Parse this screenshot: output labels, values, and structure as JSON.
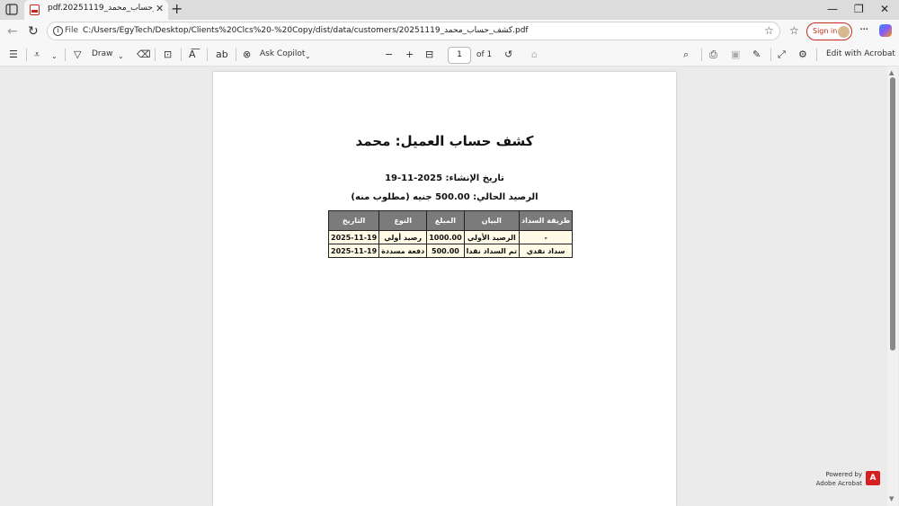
{
  "browser": {
    "tab_title": "pdf.20251119_كشف_حساب_محمد",
    "tab_close": "✕",
    "new_tab": "+",
    "scheme": "File",
    "url": "C:/Users/EgyTech/Desktop/Clients%20Clcs%20-%20Copy/dist/data/customers/20251119_كشف_حساب_محمد.pdf",
    "sign_in": "Sign in",
    "window_controls": [
      "—",
      "❐",
      "✕"
    ]
  },
  "toolbar": {
    "draw_label": "Draw",
    "ask_copilot_label": "Ask Copilot",
    "page_number": "1",
    "page_of": "of 1",
    "edit_acrobat_label": "Edit with Acrobat"
  },
  "document": {
    "title": "كشف حساب العميل: محمد",
    "created": "تاريخ الإنشاء: 2025-11-19",
    "balance": "الرصيد الحالي: 500.00 جنيه (مطلوب منه)",
    "table": {
      "headers": [
        "التاريخ",
        "النوع",
        "المبلغ",
        "البيان",
        "طريقة السداد"
      ],
      "rows": [
        [
          "2025-11-19",
          "رصيد أولي",
          "1000.00",
          "الرصيد الأولي",
          "-"
        ],
        [
          "2025-11-19",
          "دفعة مسددة",
          "500.00",
          "تم السداد نقدا",
          "سداد نقدي"
        ]
      ]
    }
  },
  "footer": {
    "powered_by": "Powered by",
    "powered_brand": "Adobe Acrobat"
  },
  "icons": {
    "accent": "#c42b1c"
  }
}
